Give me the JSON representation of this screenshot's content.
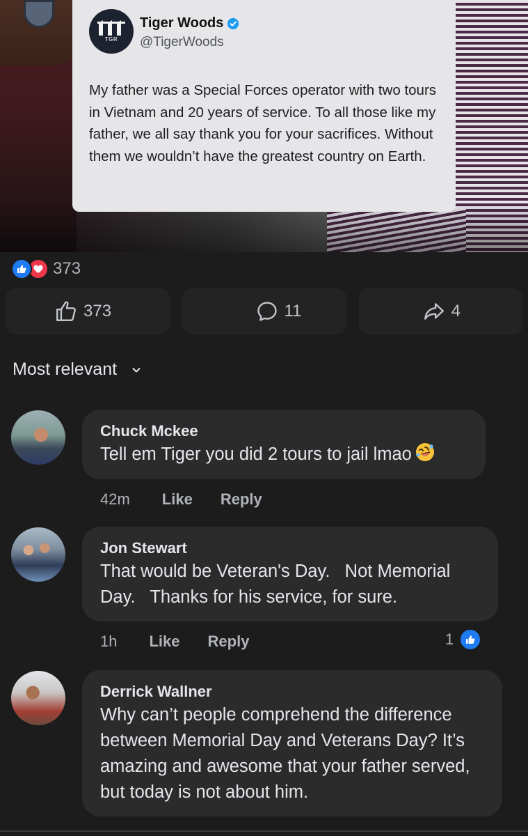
{
  "tweet": {
    "avatar_text": "TGR",
    "name": "Tiger Woods",
    "handle": "@TigerWoods",
    "text": "My father was a Special Forces operator with two tours in Vietnam and 20 years of service. To all those like my father, we all say thank you for your sacrifices. Without them we wouldn’t have the greatest country on Earth."
  },
  "reactions": {
    "count": "373",
    "icons": [
      "like-icon",
      "love-icon"
    ]
  },
  "actions": {
    "like_count": "373",
    "comment_count": "11",
    "share_count": "4"
  },
  "sort": {
    "label": "Most relevant"
  },
  "comments": [
    {
      "author": "Chuck Mckee",
      "text": "Tell em Tiger you did 2 tours to jail lmao",
      "emoji": "rolling-on-floor-laughing",
      "time": "42m",
      "like_label": "Like",
      "reply_label": "Reply"
    },
    {
      "author": "Jon Stewart",
      "text": "That would be Veteran's Day.   Not Memorial Day.   Thanks for his service, for sure.",
      "time": "1h",
      "like_label": "Like",
      "reply_label": "Reply",
      "reaction_count": "1"
    },
    {
      "author": "Derrick Wallner",
      "text": "Why can’t people comprehend the difference between Memorial Day and Veterans Day? It’s amazing and awesome that your father served, but today is not about him."
    }
  ],
  "colors": {
    "background": "#1c1c1d",
    "bubble": "#2b2b2c",
    "like_blue": "#1f7bf2",
    "love_red": "#f0364b",
    "verified_blue": "#1d9bf0"
  }
}
